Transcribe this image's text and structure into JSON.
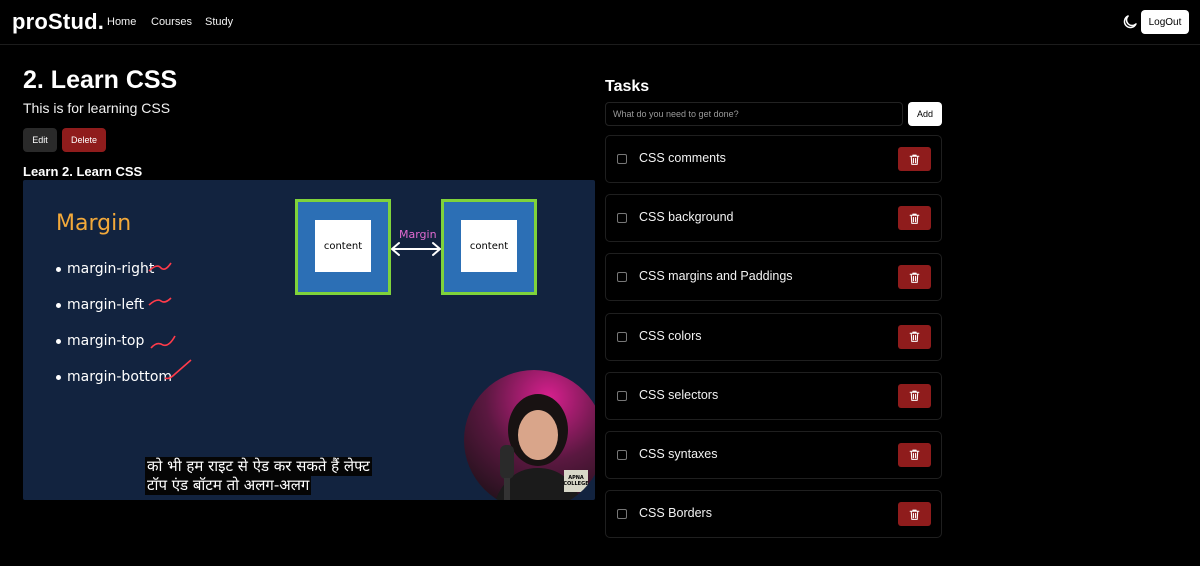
{
  "nav": {
    "logo": "proStud.",
    "links": [
      "Home",
      "Courses",
      "Study"
    ],
    "logout_label": "LogOut",
    "theme_icon": "moon-icon"
  },
  "lesson": {
    "title": "2. Learn CSS",
    "description": "This is for learning CSS",
    "edit_label": "Edit",
    "delete_label": "Delete",
    "section_heading": "Learn 2. Learn CSS"
  },
  "video": {
    "slide_title": "Margin",
    "items": [
      "margin-right",
      "margin-left",
      "margin-top",
      "margin-bottom"
    ],
    "box_label": "content",
    "margin_label": "Margin",
    "subtitle_lines": [
      "को भी हम राइट से ऐड कर सकते हैं लेफ्ट",
      "टॉप एंड बॉटम तो अलग-अलग"
    ],
    "watermark": "APNA COLLEGE"
  },
  "tasks": {
    "heading": "Tasks",
    "input_placeholder": "What do you need to get done?",
    "add_label": "Add",
    "items": [
      {
        "label": "CSS comments",
        "done": false
      },
      {
        "label": "CSS background",
        "done": false
      },
      {
        "label": "CSS margins and Paddings",
        "done": false
      },
      {
        "label": "CSS colors",
        "done": false
      },
      {
        "label": "CSS selectors",
        "done": false
      },
      {
        "label": "CSS syntaxes",
        "done": false
      },
      {
        "label": "CSS Borders",
        "done": false
      }
    ]
  },
  "colors": {
    "background": "#000000",
    "danger": "#8f1c1c",
    "slide_bg": "#12233f",
    "slide_accent": "#f3a93a",
    "box_border": "#7fd33b"
  }
}
